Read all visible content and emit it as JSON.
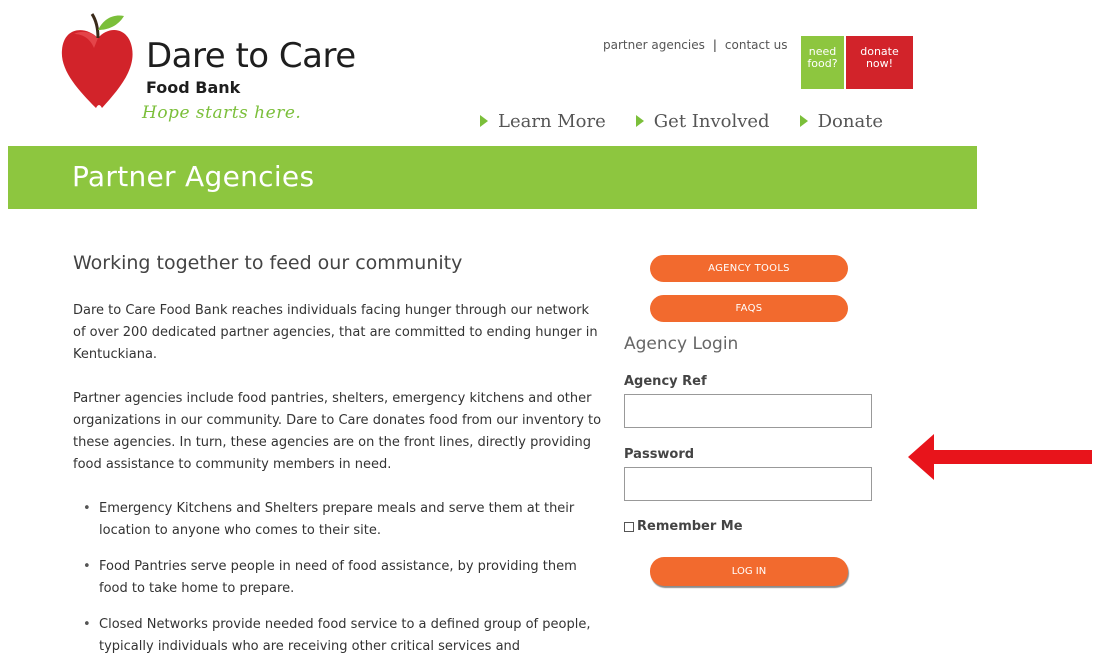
{
  "logo": {
    "brand": "Dare to Care",
    "sub": "Food Bank",
    "tagline": "Hope starts here."
  },
  "top_links": {
    "partner": "partner agencies",
    "separator": "|",
    "contact": "contact us"
  },
  "cta": {
    "need_food": [
      "need",
      "food?"
    ],
    "donate_now": [
      "donate",
      "now!"
    ]
  },
  "nav": {
    "items": [
      "Learn More",
      "Get Involved",
      "Donate"
    ]
  },
  "banner": {
    "title": "Partner Agencies"
  },
  "content": {
    "heading": "Working together to feed our community",
    "paragraphs": [
      "Dare to Care Food Bank reaches individuals facing hunger through our network of over 200 dedicated partner agencies, that are committed to ending hunger in Kentuckiana.",
      "Partner agencies include food pantries, shelters, emergency kitchens and other organizations in our community. Dare to Care donates food from our inventory to these agencies. In turn, these agencies are on the front lines, directly providing food assistance to community members in need."
    ],
    "bullets": [
      "Emergency Kitchens and Shelters prepare meals and serve them at their location to anyone who comes to their site.",
      "Food Pantries serve people in need of food assistance, by providing them food to take home to prepare.",
      "Closed Networks provide needed food service to a defined group of people, typically individuals who are receiving other critical services and"
    ]
  },
  "sidebar": {
    "agency_tools": "AGENCY TOOLS",
    "faqs": "FAQS",
    "login_heading": "Agency Login",
    "ref_label": "Agency Ref",
    "ref_value": "",
    "password_label": "Password",
    "password_value": "",
    "remember_label": "Remember Me",
    "remember_checked": false,
    "login_button": "LOG IN"
  },
  "colors": {
    "green": "#8dc63f",
    "red": "#d2232a",
    "orange": "#f26a2e",
    "annotation_arrow": "#e8141b"
  }
}
